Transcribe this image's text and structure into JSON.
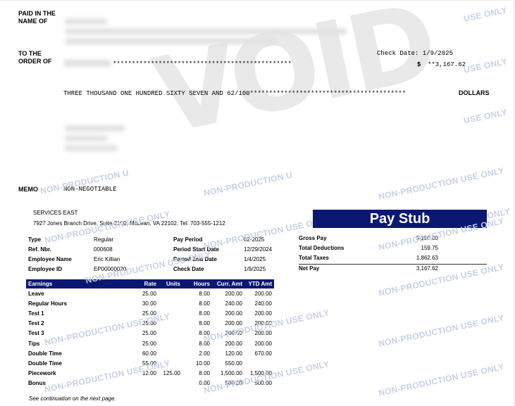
{
  "check": {
    "paid_label_1": "PAID IN THE",
    "paid_label_2": "NAME OF",
    "order_label_1": "TO THE",
    "order_label_2": "ORDER OF",
    "order_stars": "***********************************************",
    "check_date": "Check Date: 1/9/2025",
    "dollar_sign": "$",
    "amount": "**3,167.62",
    "amount_words": "THREE THOUSAND ONE HUNDRED SIXTY SEVEN AND 62/100*****************************************",
    "dollars": "DOLLARS",
    "memo_label": "MEMO",
    "memo_value": "NON-NEGOTIABLE",
    "void_text": "VOID"
  },
  "watermark": {
    "full": "NON-PRODUCTION USE ONLY",
    "tail": "USE ONLY",
    "mid": "NON-PRODUCTION USE O",
    "start": "NON-PRODUCTION U",
    "stub_tail": "ONLY"
  },
  "company": {
    "name": "SERVICES EAST",
    "address": "7927 Jones Branch Drive, Suite 3100, McLean, VA 22102.  Tel: 703-555-1212"
  },
  "stub": {
    "title": "Pay Stub",
    "type_label": "Type",
    "type": "Regular",
    "ref_label": "Ref. Nbr.",
    "ref": "000608",
    "emp_name_label": "Employee Name",
    "emp_name": "Eric Killian",
    "emp_id_label": "Employee ID",
    "emp_id": "EP00000020",
    "pay_period_label": "Pay Period",
    "pay_period": "02-2025",
    "start_label": "Period Start Date",
    "start": "12/29/2024",
    "end_label": "Period End Date",
    "end": "1/4/2025",
    "check_date_label": "Check Date",
    "check_date": "1/9/2025",
    "gross_label": "Gross Pay",
    "gross": "5,190.00",
    "deductions_label": "Total Deductions",
    "deductions": "159.75",
    "taxes_label": "Total Taxes",
    "taxes": "1,862.63",
    "net_label": "Net Pay",
    "net": "3,167.62"
  },
  "earnings": {
    "headers": [
      "Earnings",
      "Rate",
      "Units",
      "Hours",
      "Curr. Amt",
      "YTD Amt"
    ],
    "rows": [
      [
        "Leave",
        "25.00",
        "",
        "8.00",
        "200.00",
        "200.00"
      ],
      [
        "Regular Hours",
        "30.00",
        "",
        "8.00",
        "240.00",
        "240.00"
      ],
      [
        "Test 1",
        "25.00",
        "",
        "8.00",
        "200.00",
        "200.00"
      ],
      [
        "Test 2",
        "25.00",
        "",
        "8.00",
        "200.00",
        "200.00"
      ],
      [
        "Test 3",
        "25.00",
        "",
        "8.00",
        "200.00",
        "200.00"
      ],
      [
        "Tips",
        "25.00",
        "",
        "8.00",
        "200.00",
        "200.00"
      ],
      [
        "Double Time",
        "60.00",
        "",
        "2.00",
        "120.00",
        "670.00"
      ],
      [
        "Double Time",
        "55.00",
        "",
        "10.00",
        "550.00",
        ""
      ],
      [
        "Piecework",
        "12.00",
        "125.00",
        "8.00",
        "1,500.00",
        "1,500.00"
      ],
      [
        "Bonus",
        "",
        "",
        "0.00",
        "500.00",
        "500.00"
      ]
    ],
    "continuation": "See continuation on the next page."
  }
}
